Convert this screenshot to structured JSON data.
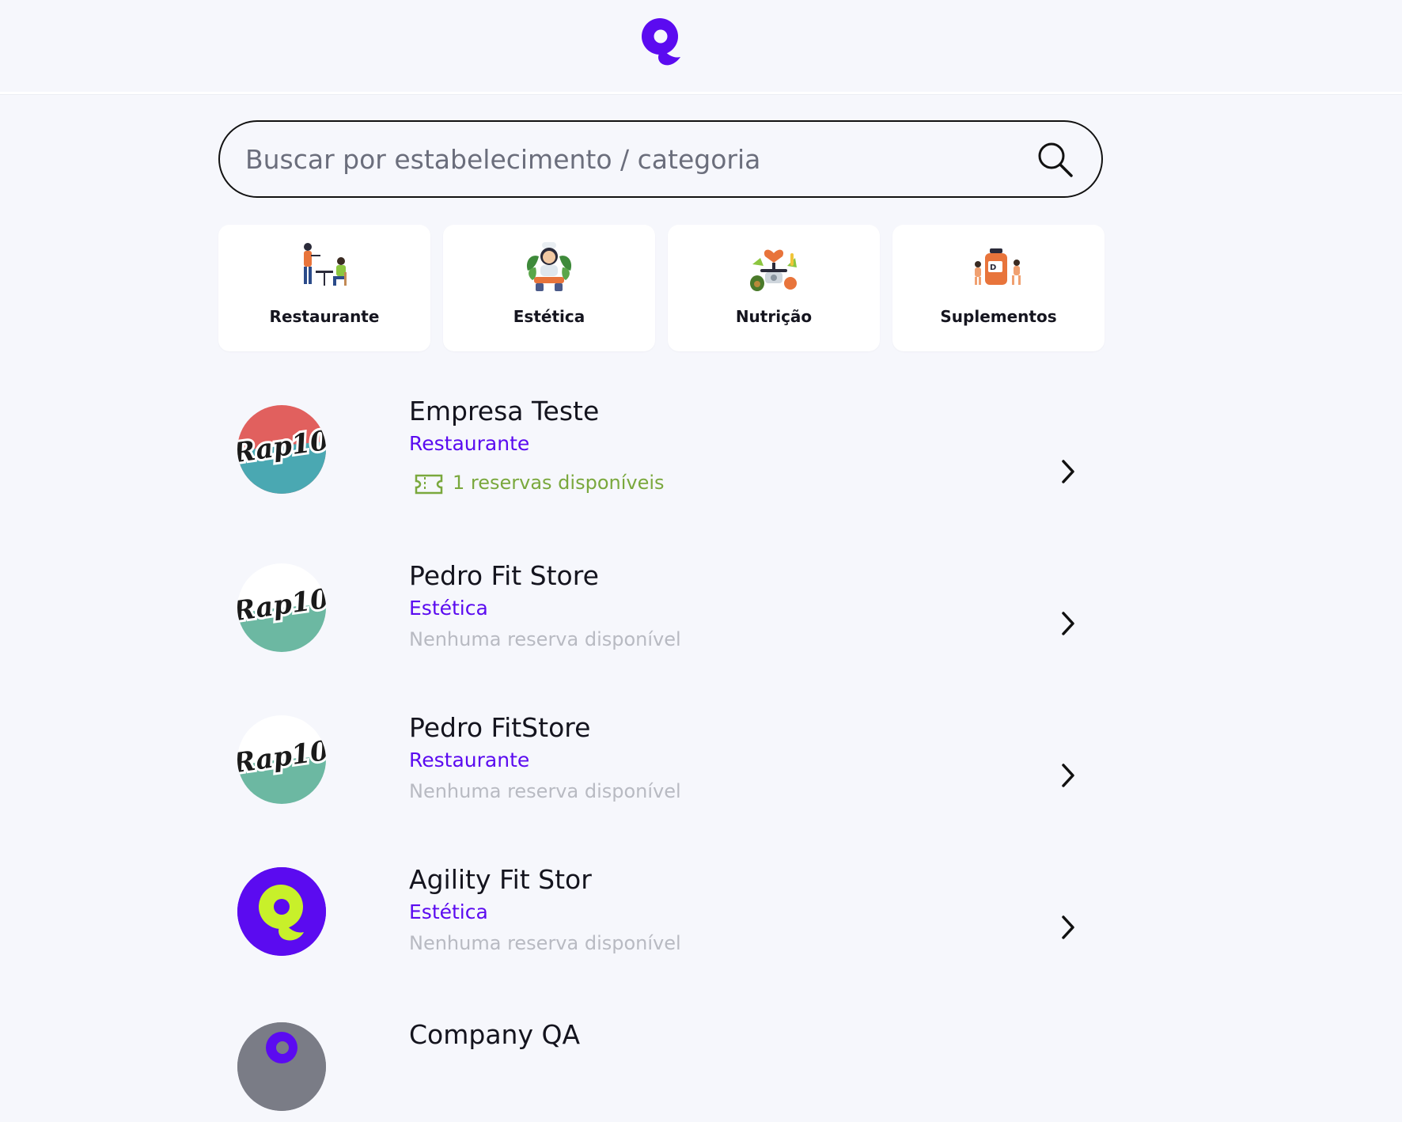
{
  "header": {
    "logo_icon": "brand-logo-icon",
    "brand_color": "#5b0bf0"
  },
  "search": {
    "placeholder": "Buscar por estabelecimento / categoria",
    "value": "",
    "icon": "search-icon"
  },
  "categories": [
    {
      "label": "Restaurante",
      "icon": "restaurant-illustration-icon"
    },
    {
      "label": "Estética",
      "icon": "aesthetics-illustration-icon"
    },
    {
      "label": "Nutrição",
      "icon": "nutrition-illustration-icon"
    },
    {
      "label": "Suplementos",
      "icon": "supplements-illustration-icon"
    }
  ],
  "establishments": [
    {
      "name": "Empresa Teste",
      "category": "Restaurante",
      "status": "1 reservas disponíveis",
      "status_type": "available",
      "logo": "rap10-logo"
    },
    {
      "name": "Pedro Fit Store",
      "category": "Estética",
      "status": "Nenhuma reserva disponível",
      "status_type": "none",
      "logo": "rap10-logo"
    },
    {
      "name": "Pedro FitStore",
      "category": "Restaurante",
      "status": "Nenhuma reserva disponível",
      "status_type": "none",
      "logo": "rap10-logo"
    },
    {
      "name": "Agility Fit Stor",
      "category": "Estética",
      "status": "Nenhuma reserva disponível",
      "status_type": "none",
      "logo": "brand-logo"
    },
    {
      "name": "Company QA",
      "category": "",
      "status": "",
      "status_type": "",
      "logo": "brand-logo"
    }
  ],
  "logo_text": "Rap10",
  "colors": {
    "accent": "#5b0bf0",
    "available": "#7aa83d",
    "unavailable": "#b8bac2",
    "lime": "#c8f02a"
  }
}
